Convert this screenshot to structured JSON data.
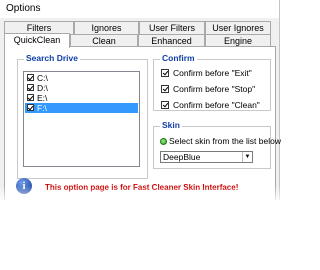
{
  "window": {
    "title": "Options"
  },
  "tabs_row1": [
    "Filters",
    "Ignores",
    "User Filters",
    "User Ignores"
  ],
  "tabs_row2": [
    "QuickClean",
    "Clean",
    "Enhanced",
    "Engine"
  ],
  "active_tab": "QuickClean",
  "search_drive": {
    "title": "Search Drive",
    "drives": [
      {
        "label": "C:\\",
        "checked": true,
        "selected": false
      },
      {
        "label": "D:\\",
        "checked": true,
        "selected": false
      },
      {
        "label": "E:\\",
        "checked": true,
        "selected": false
      },
      {
        "label": "F:\\",
        "checked": true,
        "selected": true
      }
    ]
  },
  "confirm": {
    "title": "Confirm",
    "options": [
      {
        "label": "Confirm before \"Exit\"",
        "checked": true
      },
      {
        "label": "Confirm before \"Stop\"",
        "checked": true
      },
      {
        "label": "Confirm before \"Clean\"",
        "checked": true
      }
    ]
  },
  "skin": {
    "title": "Skin",
    "radio_label": "Select skin from the list below",
    "selected_skin": "DeepBlue"
  },
  "notice": {
    "icon": "info-icon",
    "text": "This option page is for Fast Cleaner Skin Interface!"
  },
  "colors": {
    "group_title": "#0f3ea8",
    "notice_text": "#cc0000",
    "selection": "#3399ff",
    "info_icon": "#123c9b"
  }
}
